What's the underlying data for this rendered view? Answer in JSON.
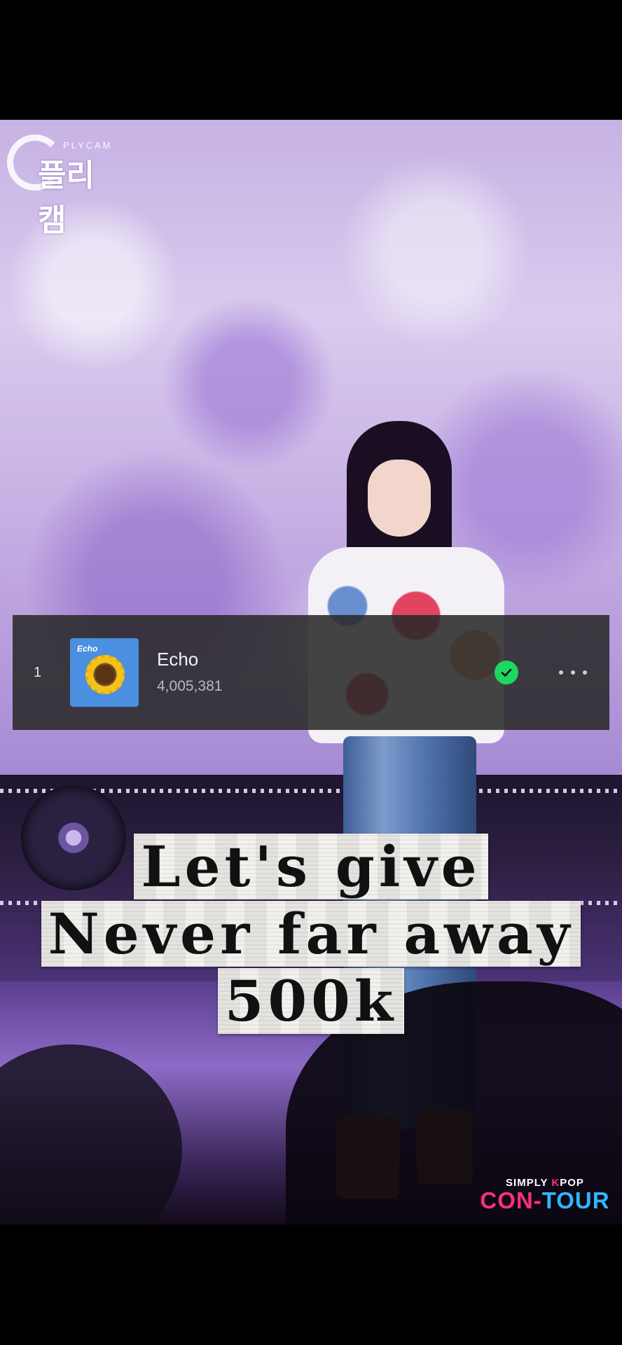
{
  "video": {
    "watermark": {
      "english": "PLYCAM",
      "korean": "플리캠"
    },
    "broadcaster_logo": {
      "line1_prefix": "SIMPLY ",
      "line1_highlight": "K",
      "line1_suffix": "POP",
      "line2_part1": "CON-",
      "line2_part2": "TOUR"
    },
    "caption": {
      "line1": "Let's give",
      "line2": "Never far away",
      "line3": "500k"
    }
  },
  "song_row": {
    "rank": "1",
    "album_art_title": "Echo",
    "album_art_icon": "sunflower",
    "title": "Echo",
    "play_count": "4,005,381",
    "downloaded_icon": "check-circle-icon",
    "downloaded_color": "#1ED760",
    "more_icon": "more-horizontal-icon"
  }
}
